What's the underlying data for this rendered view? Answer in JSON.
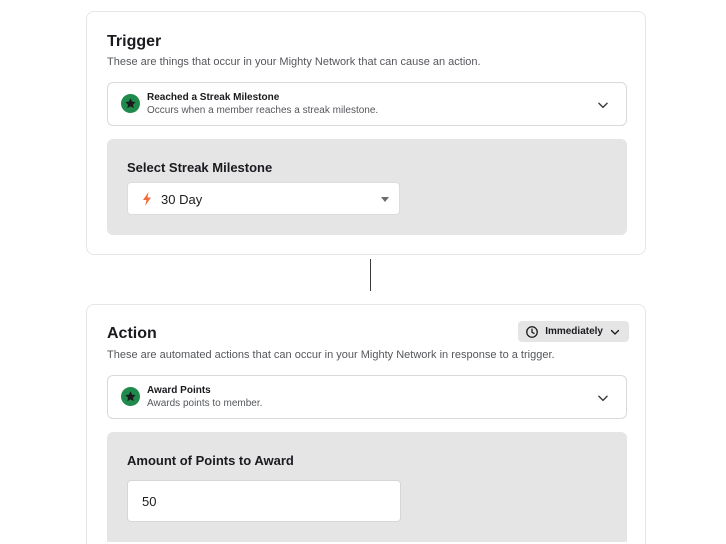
{
  "trigger": {
    "title": "Trigger",
    "description": "These are things that occur in your Mighty Network that can cause an action.",
    "selected": {
      "title": "Reached a Streak Milestone",
      "subtitle": "Occurs when a member reaches a streak milestone.",
      "icon": "star-badge-icon"
    },
    "panel": {
      "label": "Select Streak Milestone",
      "dropdown_value": "30 Day",
      "dropdown_icon": "bolt-icon"
    }
  },
  "action": {
    "title": "Action",
    "description": "These are automated actions that can occur in your Mighty Network in response to a trigger.",
    "timing_label": "Immediately",
    "selected": {
      "title": "Award Points",
      "subtitle": "Awards points to member.",
      "icon": "star-badge-icon"
    },
    "panel": {
      "label": "Amount of Points to Award",
      "input_value": "50"
    }
  },
  "colors": {
    "badge_green": "#1f8a4c",
    "bolt_orange": "#f26b3a",
    "panel_gray": "#e5e5e6"
  }
}
